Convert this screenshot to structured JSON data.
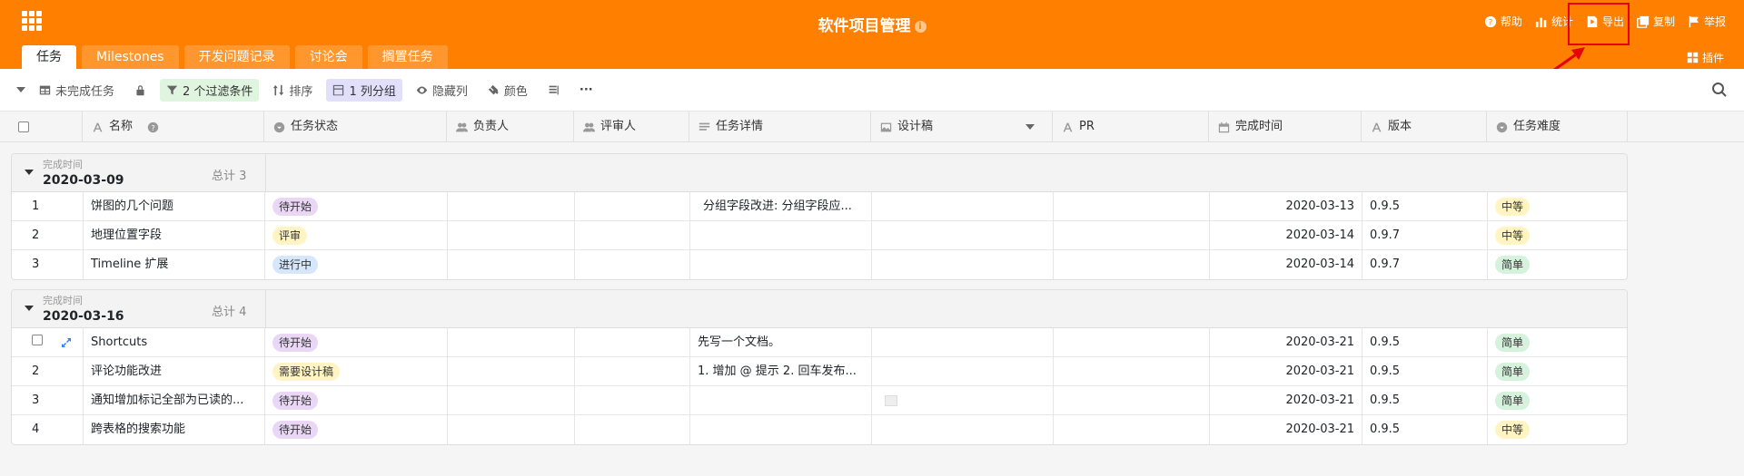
{
  "header": {
    "title": "软件项目管理",
    "actions": [
      {
        "label": "帮助",
        "icon": "help-icon"
      },
      {
        "label": "统计",
        "icon": "chart-icon"
      },
      {
        "label": "导出",
        "icon": "export-icon"
      },
      {
        "label": "复制",
        "icon": "copy-icon"
      },
      {
        "label": "举报",
        "icon": "flag-icon"
      }
    ],
    "plugins": "插件"
  },
  "tabs": [
    "任务",
    "Milestones",
    "开发问题记录",
    "讨论会",
    "搁置任务"
  ],
  "toolbar": {
    "view": "未完成任务",
    "filter": "2 个过滤条件",
    "sort": "排序",
    "group": "1 列分组",
    "hide": "隐藏列",
    "color": "颜色",
    "more": "···"
  },
  "columns": [
    "名称",
    "任务状态",
    "负责人",
    "评审人",
    "任务详情",
    "设计稿",
    "PR",
    "完成时间",
    "版本",
    "任务难度"
  ],
  "colors": {
    "accent": "#ff8000",
    "highlight": "#e8000b"
  },
  "groups": [
    {
      "field": "完成时间",
      "value": "2020-03-09",
      "count": "总计 3",
      "rows": [
        {
          "idx": "1",
          "name": "饼图的几个问题",
          "status": "待开始",
          "detail": "分组字段改进: 分组字段应...",
          "date": "2020-03-13",
          "version": "0.9.5",
          "difficulty": "中等"
        },
        {
          "idx": "2",
          "name": "地理位置字段",
          "status": "评审",
          "detail": "",
          "date": "2020-03-14",
          "version": "0.9.7",
          "difficulty": "中等"
        },
        {
          "idx": "3",
          "name": "Timeline 扩展",
          "status": "进行中",
          "detail": "",
          "date": "2020-03-14",
          "version": "0.9.7",
          "difficulty": "简单"
        }
      ]
    },
    {
      "field": "完成时间",
      "value": "2020-03-16",
      "count": "总计 4",
      "rows": [
        {
          "idx": "",
          "name": "Shortcuts",
          "status": "待开始",
          "detail": "先写一个文档。",
          "date": "2020-03-21",
          "version": "0.9.5",
          "difficulty": "简单"
        },
        {
          "idx": "2",
          "name": "评论功能改进",
          "status": "需要设计稿",
          "detail": "1. 增加 @ 提示 2. 回车发布...",
          "date": "2020-03-21",
          "version": "0.9.5",
          "difficulty": "简单"
        },
        {
          "idx": "3",
          "name": "通知增加标记全部为已读的...",
          "status": "待开始",
          "detail": "",
          "date": "2020-03-21",
          "version": "0.9.5",
          "difficulty": "简单"
        },
        {
          "idx": "4",
          "name": "跨表格的搜索功能",
          "status": "待开始",
          "detail": "",
          "date": "2020-03-21",
          "version": "0.9.5",
          "difficulty": "中等"
        }
      ]
    }
  ]
}
